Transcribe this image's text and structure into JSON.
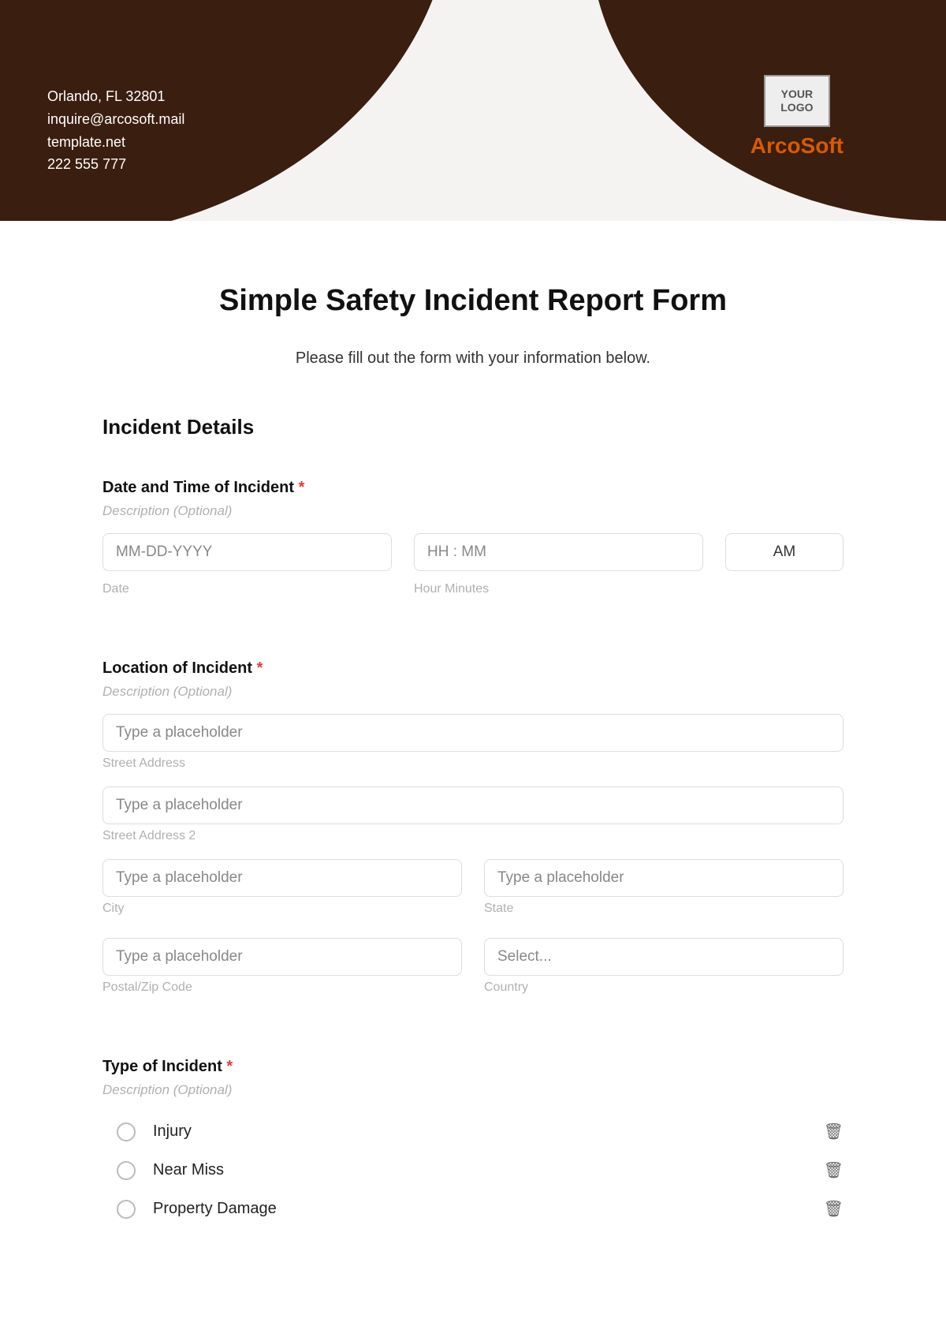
{
  "header": {
    "contact": {
      "address": "Orlando, FL 32801",
      "email": "inquire@arcosoft.mail",
      "website": "template.net",
      "phone": "222 555 777"
    },
    "logo_text": "YOUR\nLOGO",
    "brand": "ArcoSoft"
  },
  "form": {
    "title": "Simple Safety Incident Report Form",
    "subtitle": "Please fill out the form with your information below.",
    "section1": "Incident Details",
    "datetime": {
      "label": "Date and Time of Incident",
      "required": "*",
      "desc": "Description (Optional)",
      "date_placeholder": "MM-DD-YYYY",
      "date_sub": "Date",
      "time_placeholder": "HH : MM",
      "time_sub": "Hour Minutes",
      "ampm": "AM"
    },
    "location": {
      "label": "Location of Incident",
      "required": "*",
      "desc": "Description (Optional)",
      "placeholder": "Type a placeholder",
      "street": "Street Address",
      "street2": "Street Address 2",
      "city": "City",
      "state": "State",
      "postal": "Postal/Zip Code",
      "country": "Country",
      "country_placeholder": "Select..."
    },
    "type": {
      "label": "Type of Incident",
      "required": "*",
      "desc": "Description (Optional)",
      "options": [
        "Injury",
        "Near Miss",
        "Property Damage"
      ]
    }
  }
}
